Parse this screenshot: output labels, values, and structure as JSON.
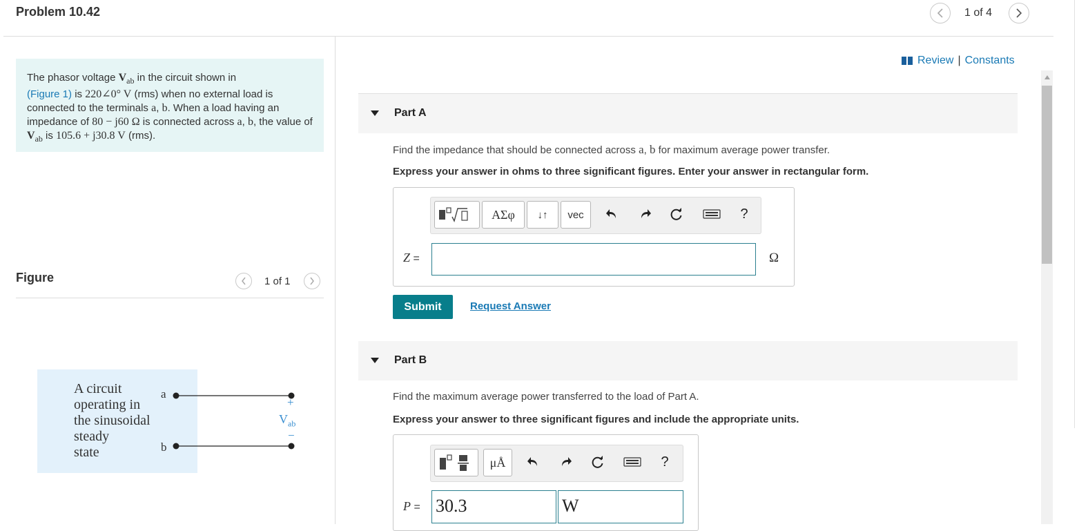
{
  "header": {
    "title": "Problem 10.42",
    "pager": "1 of 4"
  },
  "problem": {
    "t1": "The phasor voltage ",
    "v_sym": "V",
    "v_sub": "ab",
    "t2": " in the circuit shown in",
    "figure_link": "(Figure 1)",
    "t3": " is ",
    "voltage": "220∠0° V",
    "t4": " (rms) when no external load is connected to the terminals ",
    "a": "a",
    "comma": ", ",
    "b": "b",
    "t5": ". When a load having an impedance of ",
    "impedance": "80 − j60 Ω",
    "t6": " is connected across ",
    "t7": ", the value of ",
    "t8": " is ",
    "loaded_value": "105.6 + j30.8 V",
    "t9": " (rms)."
  },
  "figure": {
    "label": "Figure",
    "pager": "1 of 1",
    "circuit_lines": [
      "A circuit",
      "operating in",
      "the sinusoidal",
      "steady",
      "state"
    ],
    "terminal_a": "a",
    "terminal_b": "b",
    "plus": "+",
    "minus": "−",
    "v_label": "V",
    "v_sub": "ab"
  },
  "review": {
    "review": "Review",
    "separator": "|",
    "constants": "Constants"
  },
  "partA": {
    "title": "Part A",
    "question_pre": "Find the impedance that should be connected across ",
    "a": "a",
    "comma": ", ",
    "b": "b",
    "question_post": " for maximum average power transfer.",
    "instruction": "Express your answer in ohms to three significant figures. Enter your answer in rectangular form.",
    "toolbar": {
      "greek": "ΑΣφ",
      "arrows": "↓↑",
      "vec": "vec",
      "help": "?"
    },
    "var_label": "Z",
    "equals": " =",
    "input_value": "",
    "unit": "Ω",
    "submit": "Submit",
    "request": "Request Answer"
  },
  "partB": {
    "title": "Part B",
    "question": "Find the maximum average power transferred to the load of Part A.",
    "instruction": "Express your answer to three significant figures and include the appropriate units.",
    "toolbar": {
      "units": "μÅ",
      "help": "?"
    },
    "var_label": "P",
    "equals": " =",
    "value": "30.3",
    "unit_value": "W"
  }
}
